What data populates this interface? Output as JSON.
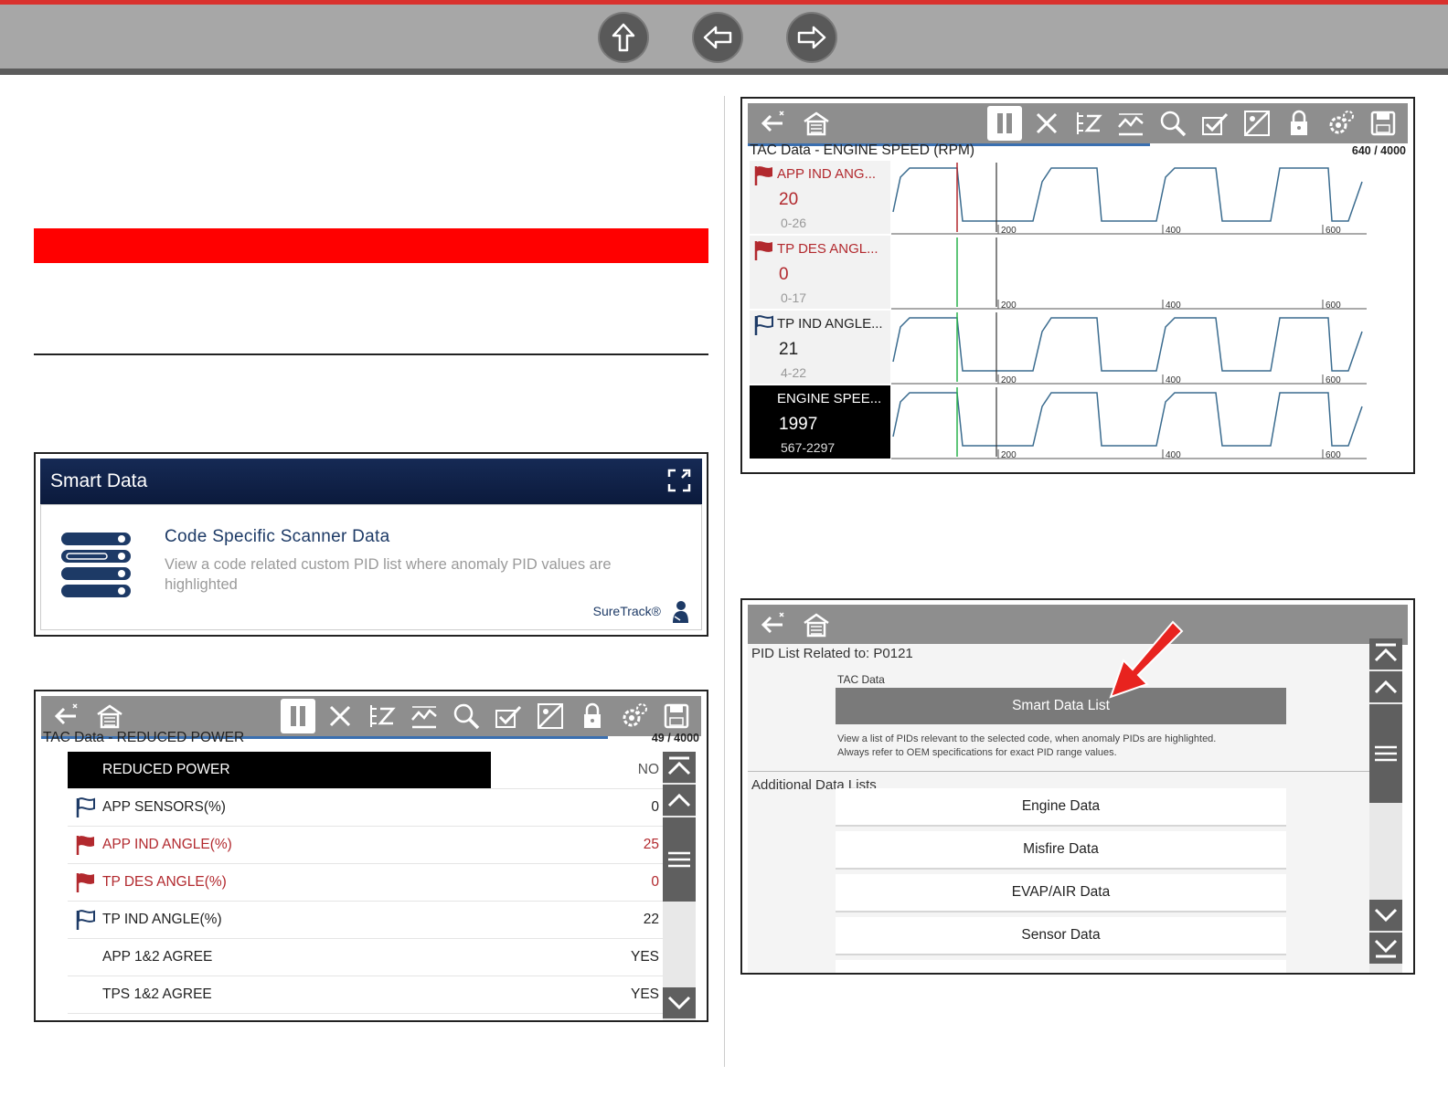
{
  "nav": {
    "up_icon": "up-arrow-icon",
    "back_icon": "left-arrow-icon",
    "forward_icon": "right-arrow-icon"
  },
  "smart_card": {
    "header": "Smart Data",
    "title": "Code Specific Scanner Data",
    "description": "View a code related custom PID list where anomaly PID values are highlighted",
    "suretrack": "SureTrack®"
  },
  "pid_screen": {
    "title": "TAC Data - REDUCED POWER",
    "count": "49 / 4000",
    "rows": [
      {
        "label": "REDUCED POWER",
        "value": "NO",
        "flag": "none",
        "state": "selected"
      },
      {
        "label": "APP SENSORS(%)",
        "value": "0",
        "flag": "outline",
        "state": "normal"
      },
      {
        "label": "APP IND ANGLE(%)",
        "value": "25",
        "flag": "filled",
        "state": "anomaly"
      },
      {
        "label": "TP DES ANGLE(%)",
        "value": "0",
        "flag": "filled",
        "state": "anomaly"
      },
      {
        "label": "TP IND ANGLE(%)",
        "value": "22",
        "flag": "outline",
        "state": "normal"
      },
      {
        "label": "APP 1&2 AGREE",
        "value": "YES",
        "flag": "none",
        "state": "normal"
      },
      {
        "label": "TPS 1&2 AGREE",
        "value": "YES",
        "flag": "none",
        "state": "normal"
      }
    ]
  },
  "graph_screen": {
    "title": "TAC Data - ENGINE SPEED (RPM)",
    "count": "640 / 4000",
    "tick_labels": [
      "200",
      "400",
      "600"
    ],
    "traces": [
      {
        "name": "APP IND ANG...",
        "value": "20",
        "range": "0-26",
        "style": "anomaly"
      },
      {
        "name": "TP DES ANGL...",
        "value": "0",
        "range": "0-17",
        "style": "anomaly"
      },
      {
        "name": "TP IND ANGLE...",
        "value": "21",
        "range": "4-22",
        "style": "normal"
      },
      {
        "name": "ENGINE SPEE...",
        "value": "1997",
        "range": "567-2297",
        "style": "selected"
      }
    ]
  },
  "related_screen": {
    "title": "PID List Related to:  P0121",
    "section_label": "TAC Data",
    "smart_button": "Smart Data List",
    "description_line1": "View a list of PIDs relevant to the selected code, when anomaly PIDs are highlighted.",
    "description_line2": "Always refer to OEM specifications for exact PID range values.",
    "additional_label": "Additional Data Lists",
    "lists": [
      "Engine Data",
      "Misfire Data",
      "EVAP/AIR Data",
      "Sensor Data"
    ]
  },
  "colors": {
    "accent_red": "#ff0000",
    "anomaly_red": "#b2292e",
    "toolbar_gray": "#8e8e8e",
    "header_navy": "#162a55"
  }
}
